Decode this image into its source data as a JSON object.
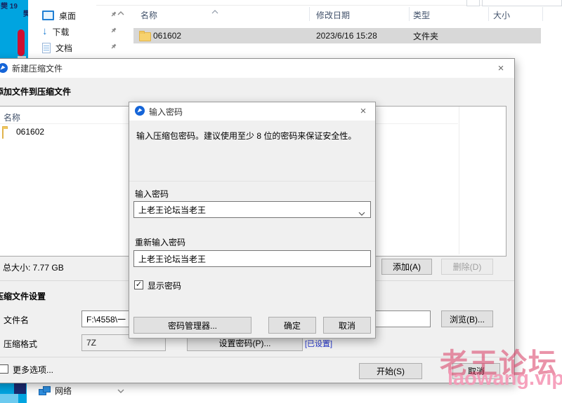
{
  "desktop": {
    "icon_label_1": "樊 19",
    "icon_label_2": "樊"
  },
  "explorer": {
    "sidebar": {
      "items": [
        {
          "label": "桌面"
        },
        {
          "label": "下载"
        },
        {
          "label": "文档"
        },
        {
          "label": "网络"
        }
      ]
    },
    "columns": {
      "name": "名称",
      "modified": "修改日期",
      "type": "类型",
      "size": "大小"
    },
    "file_row": {
      "name": "061602",
      "modified": "2023/6/16 15:28",
      "type": "文件夹",
      "size": ""
    }
  },
  "archive_dialog": {
    "title": "新建压缩文件",
    "close_glyph": "×",
    "section_add": "添加文件到压缩文件",
    "list_header_name": "名称",
    "list_item_name": "061602",
    "total_size": "总大小: 7.77 GB",
    "add_button": "添加(A)",
    "delete_button": "删除(D)",
    "section_settings": "压缩文件设置",
    "filename_label": "文件名",
    "filename_value": "F:\\4558\\一",
    "browse_button": "浏览(B)...",
    "format_label": "压缩格式",
    "format_value": "7Z",
    "set_password_button": "设置密码(P)...",
    "password_set_link": "[已设置]",
    "more_options_label": "更多选项...",
    "start_button": "开始(S)",
    "cancel_button": "取消"
  },
  "password_dialog": {
    "title": "输入密码",
    "close_glyph": "×",
    "description": "输入压缩包密码。建议使用至少 8 位的密码来保证安全性。",
    "password_label": "输入密码",
    "password_value": "上老王论坛当老王",
    "confirm_label": "重新输入密码",
    "confirm_value": "上老王论坛当老王",
    "show_password_label": "显示密码",
    "manager_button": "密码管理器...",
    "ok_button": "确定",
    "cancel_button": "取消"
  },
  "watermark": {
    "line1": "老王论坛",
    "line2": "laowang.vip"
  }
}
